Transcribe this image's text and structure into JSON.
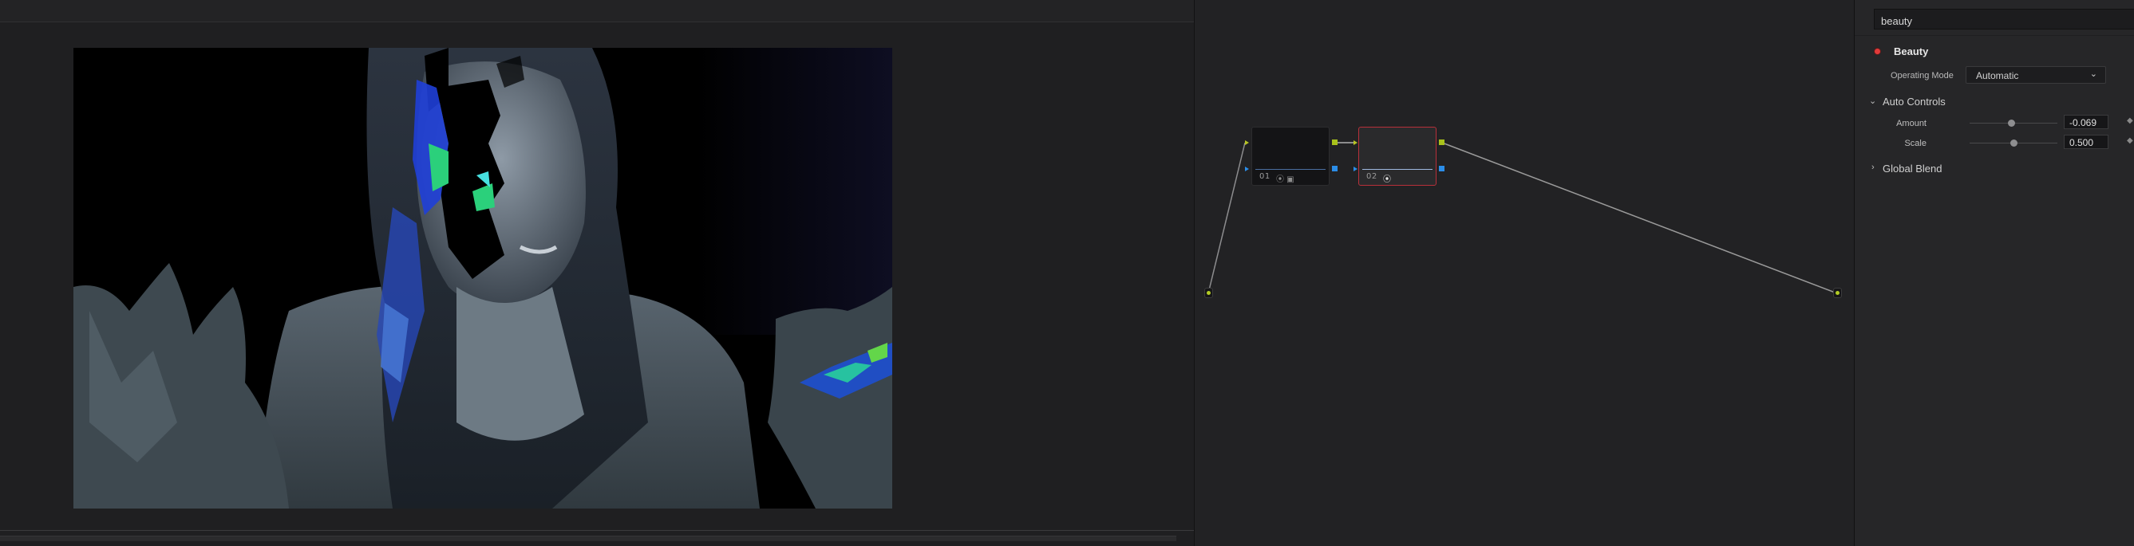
{
  "inspector": {
    "search_value": "beauty",
    "effect_title": "Beauty",
    "operating_mode": {
      "label": "Operating Mode",
      "value": "Automatic"
    },
    "auto_controls": {
      "label": "Auto Controls",
      "params": [
        {
          "name": "Amount",
          "value": "-0.069",
          "level": 0.47
        },
        {
          "name": "Scale",
          "value": "0.500",
          "level": 0.5
        }
      ]
    },
    "global_blend": {
      "label": "Global Blend"
    }
  },
  "node_graph": {
    "nodes": [
      {
        "label": "01",
        "icons": "⦿ ▣"
      },
      {
        "label": "02",
        "icons": "⦿"
      }
    ]
  },
  "colors": {
    "selected_node_border": "#b8303a",
    "port_green": "#a9c21b",
    "port_blue": "#2b8de8",
    "fx_enabled": "#e23a3a"
  }
}
